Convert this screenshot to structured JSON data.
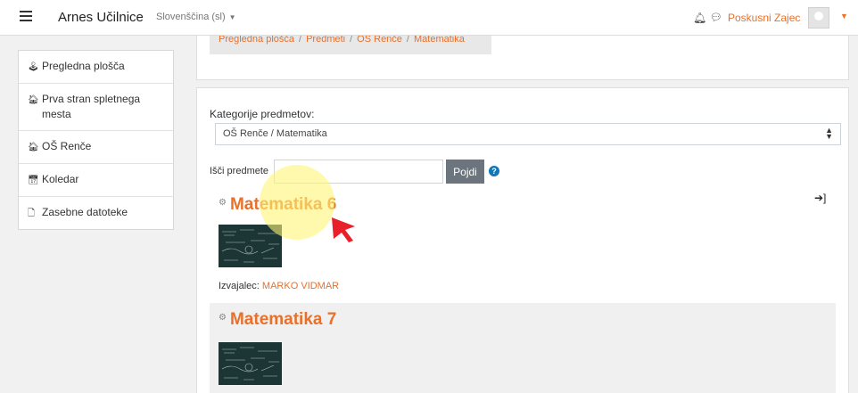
{
  "header": {
    "site_name": "Arnes Učilnice",
    "language": "Slovenščina (sl)",
    "username": "Poskusni Zajec"
  },
  "sidebar": {
    "items": [
      {
        "label": "Pregledna plošča",
        "icon": "dashboard-icon"
      },
      {
        "label": "Prva stran spletnega mesta",
        "icon": "home-icon"
      },
      {
        "label": "OŠ Renče",
        "icon": "home-icon"
      },
      {
        "label": "Koledar",
        "icon": "calendar-icon"
      },
      {
        "label": "Zasebne datoteke",
        "icon": "file-icon"
      }
    ]
  },
  "breadcrumb": [
    "Pregledna plošča",
    "Predmeti",
    "OŠ Renče",
    "Matematika"
  ],
  "main": {
    "category_label": "Kategorije predmetov:",
    "category_value": "OŠ Renče / Matematika",
    "search_label": "Išči predmete",
    "search_value": "",
    "search_button": "Pojdi"
  },
  "courses": [
    {
      "title": "Matematika 6",
      "teacher_label": "Izvajalec:",
      "teacher_name": "MARKO VIDMAR"
    },
    {
      "title": "Matematika 7"
    }
  ],
  "colors": {
    "accent": "#e8702a",
    "button": "#6c757d",
    "help": "#1177b8"
  }
}
